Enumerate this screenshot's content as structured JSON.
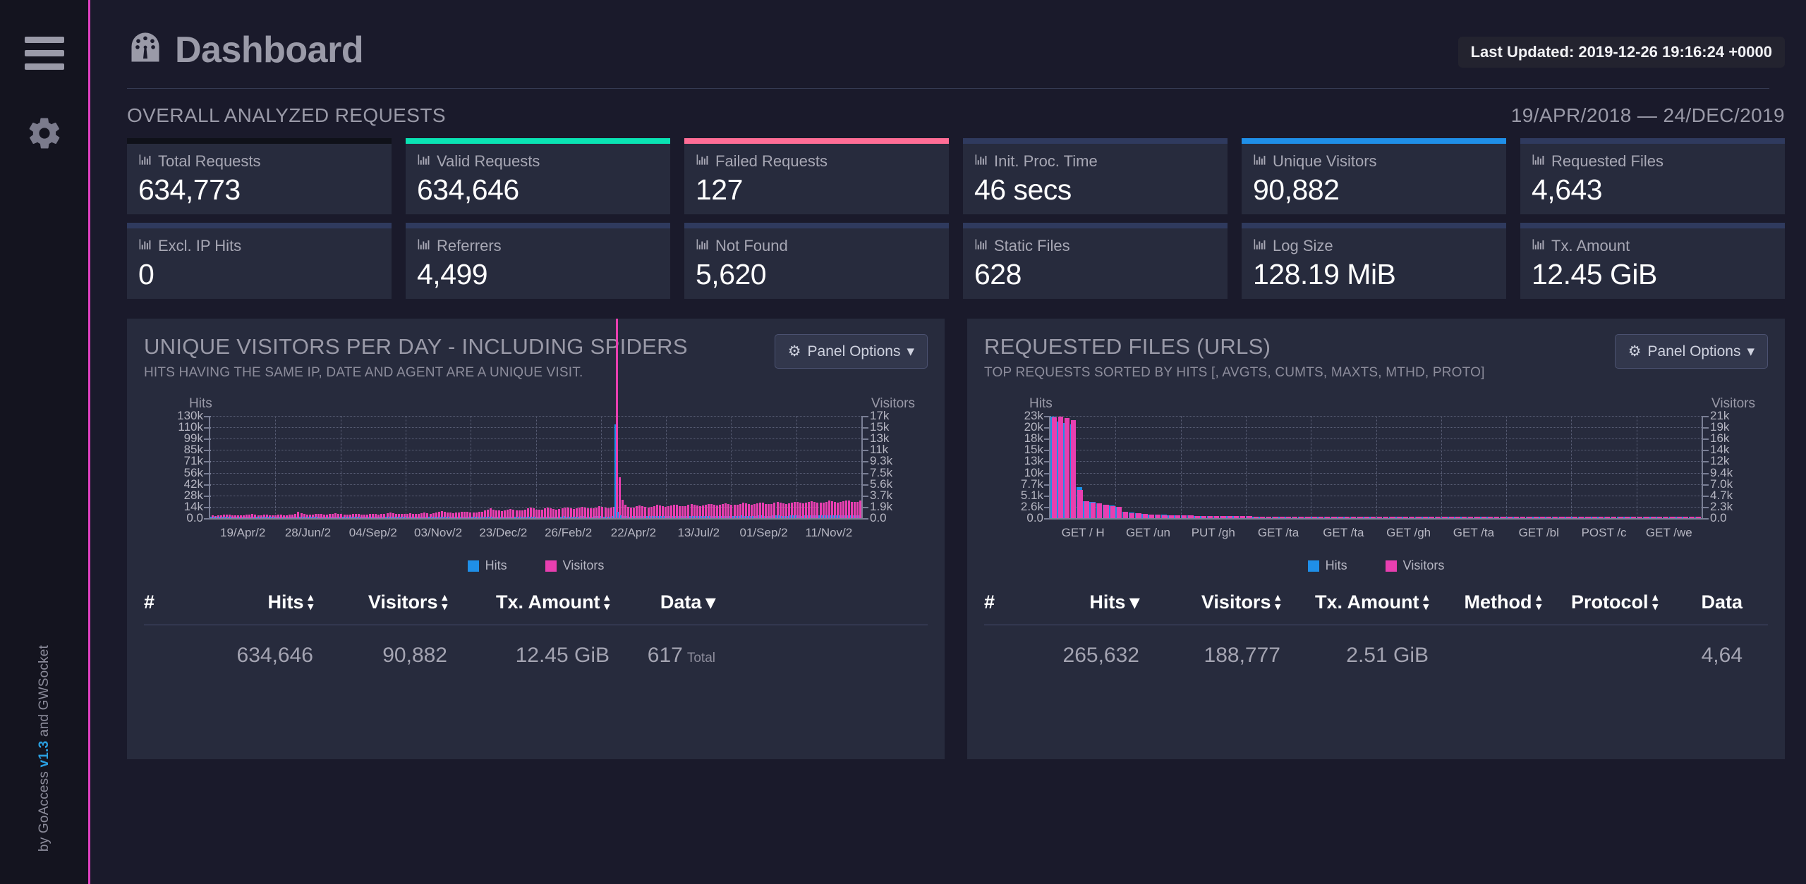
{
  "sidebar": {
    "menu_icon": "hamburger-menu-icon",
    "gear_icon": "gear-icon",
    "credit_prefix": "by GoAccess ",
    "credit_version": "v1.3",
    "credit_suffix": " and GWSocket"
  },
  "header": {
    "logo_icon": "dashboard-gauge-icon",
    "title": "Dashboard",
    "last_updated": "Last Updated: 2019-12-26 19:16:24 +0000"
  },
  "overview": {
    "title": "OVERALL ANALYZED REQUESTS",
    "date_range": "19/APR/2018 — 24/DEC/2019",
    "cards": [
      {
        "label": "Total Requests",
        "value": "634,773",
        "bar": "#0f1119",
        "icon": "bar-chart-icon"
      },
      {
        "label": "Valid Requests",
        "value": "634,646",
        "bar": "#0ae3b4",
        "icon": "bar-chart-icon"
      },
      {
        "label": "Failed Requests",
        "value": "127",
        "bar": "#ff6d96",
        "icon": "bar-chart-icon"
      },
      {
        "label": "Init. Proc. Time",
        "value": "46 secs",
        "bar": "#2f3a5e",
        "icon": "bar-chart-icon"
      },
      {
        "label": "Unique Visitors",
        "value": "90,882",
        "bar": "#1f8fe8",
        "icon": "bar-chart-icon"
      },
      {
        "label": "Requested Files",
        "value": "4,643",
        "bar": "#2f3a5e",
        "icon": "bar-chart-icon"
      },
      {
        "label": "Excl. IP Hits",
        "value": "0",
        "bar": "#2f3a5e",
        "icon": "bar-chart-icon"
      },
      {
        "label": "Referrers",
        "value": "4,499",
        "bar": "#2f3a5e",
        "icon": "bar-chart-icon"
      },
      {
        "label": "Not Found",
        "value": "5,620",
        "bar": "#2f3a5e",
        "icon": "bar-chart-icon"
      },
      {
        "label": "Static Files",
        "value": "628",
        "bar": "#2f3a5e",
        "icon": "bar-chart-icon"
      },
      {
        "label": "Log Size",
        "value": "128.19 MiB",
        "bar": "#2f3a5e",
        "icon": "bar-chart-icon"
      },
      {
        "label": "Tx. Amount",
        "value": "12.45 GiB",
        "bar": "#2f3a5e",
        "icon": "bar-chart-icon"
      }
    ]
  },
  "panels": [
    {
      "title": "UNIQUE VISITORS PER DAY - INCLUDING SPIDERS",
      "subtitle": "HITS HAVING THE SAME IP, DATE AND AGENT ARE A UNIQUE VISIT.",
      "options_label": "Panel Options",
      "options_icon": "gear-icon",
      "caret_icon": "chevron-down-icon",
      "table": {
        "columns": [
          "#",
          "Hits",
          "Visitors",
          "Tx. Amount",
          "Data"
        ],
        "sorts": [
          "none",
          "both",
          "both",
          "both",
          "desc"
        ],
        "row": [
          "",
          "634,646",
          "90,882",
          "12.45 GiB",
          "617"
        ],
        "row_suffix": "Total"
      }
    },
    {
      "title": "REQUESTED FILES (URLS)",
      "subtitle": "TOP REQUESTS SORTED BY HITS [, AVGTS, CUMTS, MAXTS, MTHD, PROTO]",
      "options_label": "Panel Options",
      "options_icon": "gear-icon",
      "caret_icon": "chevron-down-icon",
      "table": {
        "columns": [
          "#",
          "Hits",
          "Visitors",
          "Tx. Amount",
          "Method",
          "Protocol",
          "Data"
        ],
        "sorts": [
          "none",
          "desc",
          "both",
          "both",
          "both",
          "both",
          "none"
        ],
        "row": [
          "",
          "265,632",
          "188,777",
          "2.51 GiB",
          "",
          "",
          "4,64"
        ],
        "row_suffix": ""
      }
    }
  ],
  "chart_data": [
    {
      "type": "area",
      "title": "UNIQUE VISITORS PER DAY - INCLUDING SPIDERS",
      "ylabel": "Hits",
      "y2label": "Visitors",
      "grid": true,
      "legend": [
        "Hits",
        "Visitors"
      ],
      "legend_colors": [
        "#1f8fe8",
        "#e83fb0"
      ],
      "legend_position": "bottom",
      "ylim": [
        0,
        144000
      ],
      "y2lim": [
        0,
        18900
      ],
      "yticks": [
        "0.0",
        "14k",
        "28k",
        "42k",
        "56k",
        "71k",
        "85k",
        "99k",
        "110k",
        "130k"
      ],
      "y2ticks": [
        "0.0",
        "1.9k",
        "3.7k",
        "5.6k",
        "7.5k",
        "9.3k",
        "11k",
        "13k",
        "15k",
        "17k"
      ],
      "xticks": [
        "19/Apr/2",
        "28/Jun/2",
        "04/Sep/2",
        "03/Nov/2",
        "23/Dec/2",
        "26/Feb/2",
        "22/Apr/2",
        "13/Jul/2",
        "01/Sep/2",
        "11/Nov/2"
      ],
      "series": [
        {
          "name": "Hits",
          "color": "#1f8fe8",
          "values": [
            600,
            520,
            700,
            660,
            720,
            800,
            760,
            640,
            700,
            680,
            620,
            700,
            760,
            820,
            900,
            760,
            700,
            660,
            720,
            780,
            700,
            640,
            700,
            760,
            820,
            700,
            660,
            720,
            800,
            900,
            1400,
            1100,
            900,
            800,
            760,
            820,
            900,
            1000,
            860,
            780,
            820,
            900,
            1000,
            1100,
            1000,
            900,
            820,
            780,
            820,
            900,
            1000,
            900,
            820,
            780,
            820,
            900,
            980,
            900,
            820,
            900,
            1000,
            1100,
            1200,
            1100,
            1000,
            900,
            860,
            900,
            1000,
            1100,
            1000,
            900,
            1000,
            1100,
            1200,
            1100,
            1000,
            1100,
            1200,
            1400,
            1600,
            1500,
            1300,
            1200,
            1100,
            1200,
            1300,
            1400,
            1500,
            1400,
            1300,
            1200,
            1300,
            1400,
            1500,
            1700,
            1900,
            2200,
            2000,
            1800,
            1700,
            1600,
            1700,
            1900,
            2100,
            2000,
            1800,
            1700,
            1800,
            2000,
            2200,
            2400,
            2200,
            2000,
            1900,
            2000,
            2200,
            2400,
            2300,
            2100,
            2000,
            2100,
            2300,
            2500,
            2400,
            2200,
            2100,
            2200,
            2400,
            2600,
            2500,
            2300,
            2200,
            2300,
            2500,
            2700,
            2600,
            2400,
            2300,
            2400,
            2600,
            132000,
            9000,
            4000,
            3000,
            2600,
            2400,
            2500,
            2700,
            2900,
            2800,
            2600,
            2500,
            2600,
            2800,
            3000,
            2900,
            2700,
            2600,
            2700,
            2900,
            3100,
            3000,
            2800,
            2700,
            2800,
            3000,
            3200,
            3100,
            2900,
            2800,
            2900,
            3100,
            3300,
            3200,
            3000,
            2900,
            3000,
            3200,
            3400,
            3300,
            3100,
            3000,
            3100,
            3300,
            3500,
            3400,
            3200,
            3100,
            3200,
            3400,
            3600,
            3500,
            3300,
            3200,
            3300,
            3500,
            3700,
            3600,
            3400,
            3300,
            3400,
            3600,
            3800,
            3700,
            3500,
            3400,
            3500,
            3700,
            3900,
            3800,
            3600,
            3500,
            3600,
            3800,
            4000,
            3900,
            3700,
            3600,
            3700,
            3900,
            4100,
            4000,
            3800,
            3700,
            3800,
            4000
          ]
        },
        {
          "name": "Visitors",
          "color": "#e83fb0",
          "values": [
            500,
            440,
            560,
            540,
            600,
            660,
            620,
            540,
            580,
            560,
            520,
            580,
            620,
            680,
            740,
            640,
            580,
            560,
            600,
            640,
            580,
            540,
            580,
            620,
            680,
            580,
            560,
            600,
            660,
            740,
            1200,
            920,
            760,
            680,
            640,
            680,
            740,
            820,
            720,
            660,
            680,
            740,
            820,
            900,
            820,
            740,
            680,
            660,
            680,
            740,
            820,
            740,
            680,
            660,
            680,
            740,
            800,
            740,
            680,
            740,
            820,
            900,
            980,
            900,
            820,
            740,
            720,
            740,
            820,
            900,
            820,
            740,
            820,
            900,
            980,
            900,
            820,
            900,
            980,
            1140,
            1300,
            1220,
            1060,
            980,
            900,
            980,
            1060,
            1140,
            1220,
            1140,
            1060,
            980,
            1060,
            1140,
            1220,
            1380,
            1540,
            1780,
            1620,
            1460,
            1380,
            1300,
            1380,
            1540,
            1700,
            1620,
            1460,
            1380,
            1460,
            1620,
            1780,
            1940,
            1780,
            1620,
            1540,
            1620,
            1780,
            1940,
            1860,
            1700,
            1620,
            1700,
            1860,
            2020,
            1940,
            1780,
            1700,
            1780,
            1940,
            2100,
            2020,
            1860,
            1780,
            1860,
            2020,
            2180,
            2100,
            1940,
            1860,
            1940,
            2100,
            119000,
            7600,
            3400,
            2500,
            2100,
            1940,
            2020,
            2180,
            2340,
            2260,
            2100,
            2020,
            2100,
            2260,
            2420,
            2340,
            2180,
            2100,
            2180,
            2340,
            2500,
            2420,
            2260,
            2180,
            2260,
            2420,
            2580,
            2500,
            2340,
            2260,
            2340,
            2500,
            2660,
            2580,
            2420,
            2340,
            2420,
            2580,
            2740,
            2660,
            2500,
            2420,
            2500,
            2660,
            2820,
            2740,
            2580,
            2500,
            2580,
            2740,
            2900,
            2820,
            2660,
            2580,
            2660,
            2820,
            2980,
            2900,
            2740,
            2660,
            2740,
            2900,
            3060,
            2980,
            2820,
            2740,
            2820,
            2980,
            3140,
            3060,
            2900,
            2820,
            2900,
            3060,
            3220,
            3140,
            2980,
            2900,
            2980,
            3140,
            3300,
            3220,
            3060,
            2980,
            3060,
            3220
          ]
        }
      ]
    },
    {
      "type": "bar",
      "title": "REQUESTED FILES (URLS)",
      "ylabel": "Hits",
      "y2label": "Visitors",
      "grid": true,
      "legend": [
        "Hits",
        "Visitors"
      ],
      "legend_colors": [
        "#1f8fe8",
        "#e83fb0"
      ],
      "legend_position": "bottom",
      "ylim": [
        0,
        25600
      ],
      "y2lim": [
        0,
        23300
      ],
      "yticks": [
        "0.0",
        "2.6k",
        "5.1k",
        "7.7k",
        "10k",
        "13k",
        "15k",
        "18k",
        "20k",
        "23k"
      ],
      "y2ticks": [
        "0.0",
        "2.3k",
        "4.7k",
        "7.0k",
        "9.4k",
        "12k",
        "14k",
        "16k",
        "19k",
        "21k"
      ],
      "xticks": [
        "GET / H",
        "GET /un",
        "PUT /gh",
        "GET /ta",
        "GET /ta",
        "GET /gh",
        "GET /ta",
        "GET /bl",
        "POST /c",
        "GET /we"
      ],
      "series": [
        {
          "name": "Hits",
          "color": "#1f8fe8",
          "values": [
            25500,
            24200,
            23900,
            23400,
            7700,
            4300,
            4000,
            3700,
            3400,
            3100,
            2900,
            1600,
            1400,
            1200,
            1000,
            900,
            850,
            800,
            750,
            700,
            680,
            650,
            620,
            600,
            580,
            560,
            540,
            520,
            500,
            480,
            460,
            440,
            430,
            420,
            410,
            400,
            390,
            380,
            370,
            360,
            350,
            345,
            340,
            335,
            330,
            325,
            320,
            315,
            310,
            305,
            300,
            295,
            290,
            285,
            280,
            275,
            270,
            265,
            260,
            255,
            250,
            245,
            240,
            235,
            230,
            225,
            220,
            215,
            210,
            205,
            200,
            198,
            196,
            194,
            192,
            190,
            188,
            186,
            184,
            182,
            180,
            178,
            176,
            174,
            172,
            170,
            168,
            166,
            164,
            162,
            160,
            158,
            156,
            154,
            152,
            150,
            148,
            146,
            144,
            142
          ]
        },
        {
          "name": "Visitors",
          "color": "#e83fb0",
          "values": [
            23000,
            23100,
            22900,
            22300,
            6400,
            3900,
            3600,
            3300,
            3000,
            2800,
            2600,
            1400,
            1200,
            1050,
            900,
            820,
            770,
            720,
            680,
            640,
            620,
            590,
            560,
            545,
            525,
            510,
            490,
            470,
            455,
            435,
            420,
            400,
            390,
            380,
            372,
            363,
            354,
            345,
            336,
            327,
            318,
            314,
            309,
            304,
            300,
            295,
            291,
            286,
            282,
            277,
            273,
            268,
            264,
            259,
            255,
            250,
            245,
            241,
            236,
            232,
            227,
            223,
            218,
            214,
            209,
            205,
            200,
            196,
            191,
            186,
            182,
            180,
            178,
            176,
            175,
            173,
            171,
            169,
            167,
            165,
            164,
            162,
            160,
            158,
            156,
            155,
            153,
            151,
            149,
            147,
            145,
            144,
            142,
            140,
            138,
            136,
            135,
            133,
            131,
            129
          ]
        }
      ]
    }
  ]
}
